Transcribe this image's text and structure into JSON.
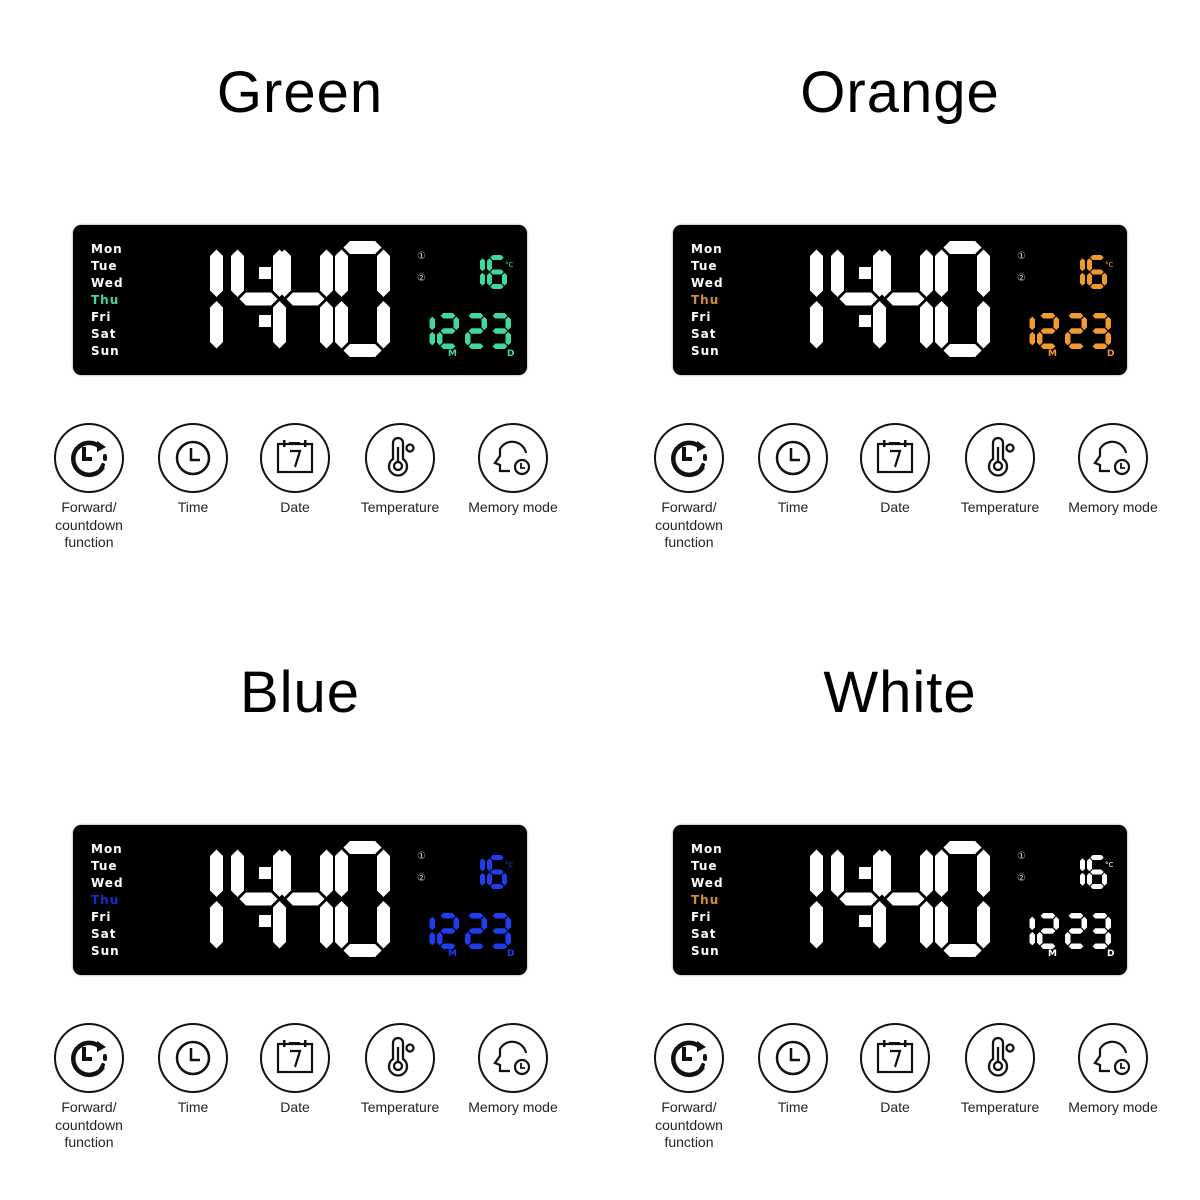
{
  "variants": [
    {
      "title": "Green",
      "accent": "#3fd9a0",
      "day_highlight": "#3fd9a0"
    },
    {
      "title": "Orange",
      "accent": "#f29a2e",
      "day_highlight": "#d9893a"
    },
    {
      "title": "Blue",
      "accent": "#1e3cf0",
      "day_highlight": "#1a2ad0"
    },
    {
      "title": "White",
      "accent": "#ffffff",
      "day_highlight": "#d9893a"
    }
  ],
  "display": {
    "days": [
      "Mon",
      "Tue",
      "Wed",
      "Thu",
      "Fri",
      "Sat",
      "Sun"
    ],
    "active_day": "Thu",
    "time": "14:40",
    "temperature": "16",
    "temperature_unit": "°C",
    "date_month": "12",
    "date_day": "23",
    "month_marker": "M",
    "day_marker": "D",
    "alarm1": "①",
    "alarm2": "②",
    "main_digit_color": "#ffffff"
  },
  "features": [
    {
      "icon": "forward-countdown-icon",
      "label": "Forward/\ncountdown\nfunction"
    },
    {
      "icon": "clock-icon",
      "label": "Time"
    },
    {
      "icon": "calendar-icon",
      "label": "Date"
    },
    {
      "icon": "thermometer-icon",
      "label": "Temperature"
    },
    {
      "icon": "memory-head-icon",
      "label": "Memory mode"
    }
  ]
}
